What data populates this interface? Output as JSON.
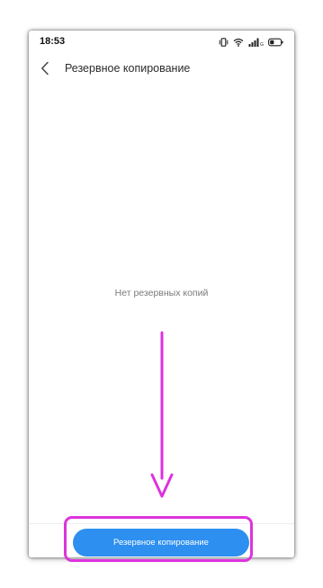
{
  "status_bar": {
    "time": "18:53",
    "network_label": "G",
    "icons": [
      "vibrate-icon",
      "wifi-icon",
      "signal-icon",
      "battery-icon"
    ]
  },
  "header": {
    "back_icon": "chevron-left-icon",
    "title": "Резервное копирование"
  },
  "main": {
    "empty_message": "Нет резервных копий"
  },
  "footer": {
    "backup_button_label": "Резервное копирование"
  },
  "colors": {
    "accent": "#2d8ff0",
    "annotation": "#dd33dd",
    "title_text": "#2b2b2b",
    "muted_text": "#7a7a7a"
  }
}
